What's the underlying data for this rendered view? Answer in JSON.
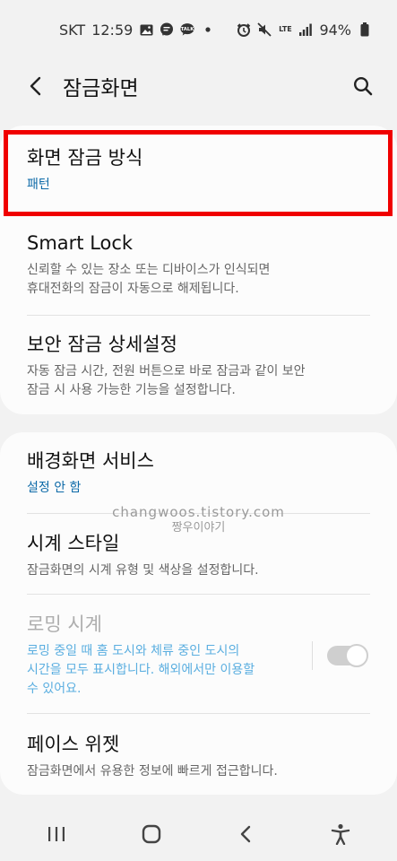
{
  "status": {
    "carrier": "SKT",
    "time": "12:59",
    "lte": "LTE",
    "battery": "94%",
    "notification_icons": [
      "gallery-icon",
      "message-icon",
      "talk-icon"
    ],
    "status_icons": [
      "alarm-icon",
      "mute-icon",
      "lte-icon",
      "signal-icon",
      "battery-icon"
    ]
  },
  "header": {
    "title": "잠금화면"
  },
  "section1": {
    "items": [
      {
        "title": "화면 잠금 방식",
        "value": "패턴"
      },
      {
        "title": "Smart Lock",
        "desc1": "신뢰할 수 있는 장소 또는 디바이스가 인식되면",
        "desc2": "휴대전화의 잠금이 자동으로 해제됩니다."
      },
      {
        "title": "보안 잠금 상세설정",
        "desc1": "자동 잠금 시간, 전원 버튼으로 바로 잠금과 같이 보안",
        "desc2": "잠금 시 사용 가능한 기능을 설정합니다."
      }
    ]
  },
  "section2": {
    "items": [
      {
        "title": "배경화면 서비스",
        "value": "설정 안 함"
      },
      {
        "title": "시계 스타일",
        "desc1": "잠금화면의 시계 유형 및 색상을 설정합니다."
      },
      {
        "title": "로밍 시계",
        "desc1": "로밍 중일 때 홈 도시와 체류 중인 도시의",
        "desc2": "시간을 모두 표시합니다. 해외에서만 이용할",
        "desc3": "수 있어요.",
        "toggle_on": true
      },
      {
        "title": "페이스 위젯",
        "desc1": "잠금화면에서 유용한 정보에 빠르게 접근합니다."
      }
    ]
  },
  "watermark": {
    "line1": "changwoos.tistory.com",
    "line2": "짱우이야기"
  },
  "colors": {
    "highlight": "#f00000",
    "accent": "#0d6aa8",
    "disabled_desc": "#5aaee0"
  }
}
